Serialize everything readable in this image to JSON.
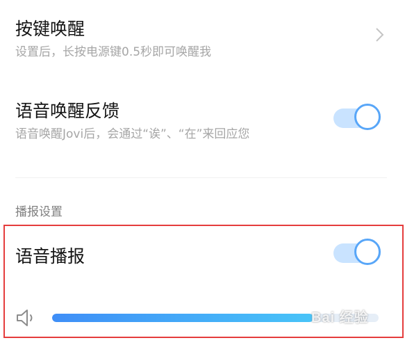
{
  "settings": {
    "key_wake": {
      "title": "按键唤醒",
      "subtitle": "设置后，长按电源键0.5秒即可唤醒我"
    },
    "voice_feedback": {
      "title": "语音唤醒反馈",
      "subtitle": "语音唤醒Jovi后，会通过“诶”、“在”来回应您",
      "enabled": true
    },
    "broadcast_section": {
      "header": "播报设置",
      "voice_broadcast": {
        "title": "语音播报",
        "enabled": true
      },
      "volume_level": 0.8
    }
  },
  "watermark_text": "Bai 经验",
  "colors": {
    "accent": "#58a6f8",
    "toggle_track": "#c9e3ff",
    "highlight_border": "#e53c3c",
    "volume_fill_start": "#3f8ef7",
    "volume_fill_end": "#48c4f8"
  }
}
